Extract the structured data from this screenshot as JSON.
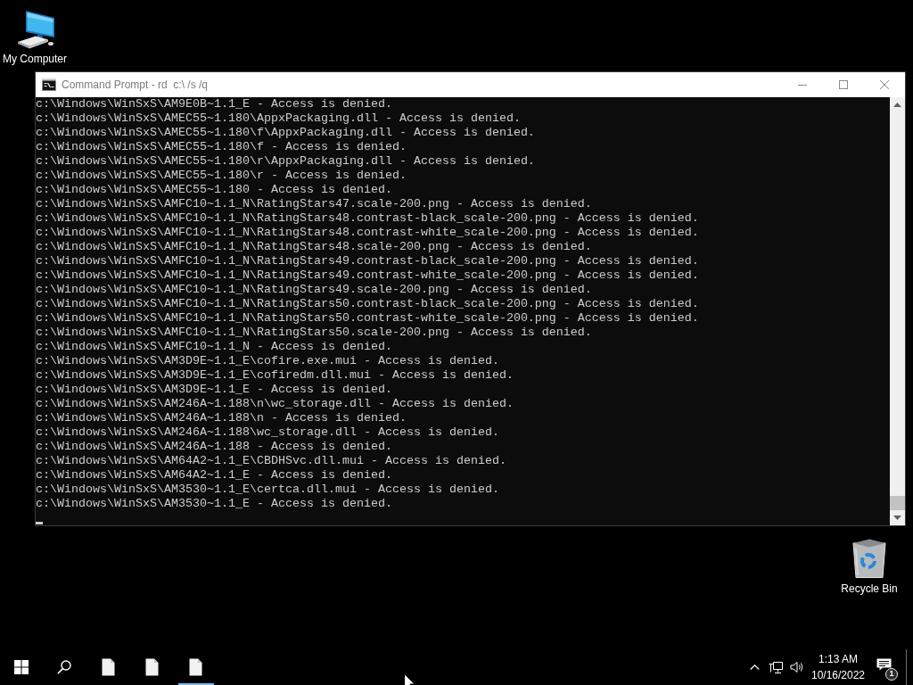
{
  "desktop_icons": [
    {
      "kind": "computer",
      "label": "My Computer"
    },
    {
      "kind": "recycle-bin",
      "label": "Recycle Bin"
    }
  ],
  "window": {
    "title": "Command Prompt - rd  c:\\ /s /q",
    "lines": [
      "c:\\Windows\\WinSxS\\AM9E0B~1.1_E - Access is denied.",
      "c:\\Windows\\WinSxS\\AMEC55~1.180\\AppxPackaging.dll - Access is denied.",
      "c:\\Windows\\WinSxS\\AMEC55~1.180\\f\\AppxPackaging.dll - Access is denied.",
      "c:\\Windows\\WinSxS\\AMEC55~1.180\\f - Access is denied.",
      "c:\\Windows\\WinSxS\\AMEC55~1.180\\r\\AppxPackaging.dll - Access is denied.",
      "c:\\Windows\\WinSxS\\AMEC55~1.180\\r - Access is denied.",
      "c:\\Windows\\WinSxS\\AMEC55~1.180 - Access is denied.",
      "c:\\Windows\\WinSxS\\AMFC10~1.1_N\\RatingStars47.scale-200.png - Access is denied.",
      "c:\\Windows\\WinSxS\\AMFC10~1.1_N\\RatingStars48.contrast-black_scale-200.png - Access is denied.",
      "c:\\Windows\\WinSxS\\AMFC10~1.1_N\\RatingStars48.contrast-white_scale-200.png - Access is denied.",
      "c:\\Windows\\WinSxS\\AMFC10~1.1_N\\RatingStars48.scale-200.png - Access is denied.",
      "c:\\Windows\\WinSxS\\AMFC10~1.1_N\\RatingStars49.contrast-black_scale-200.png - Access is denied.",
      "c:\\Windows\\WinSxS\\AMFC10~1.1_N\\RatingStars49.contrast-white_scale-200.png - Access is denied.",
      "c:\\Windows\\WinSxS\\AMFC10~1.1_N\\RatingStars49.scale-200.png - Access is denied.",
      "c:\\Windows\\WinSxS\\AMFC10~1.1_N\\RatingStars50.contrast-black_scale-200.png - Access is denied.",
      "c:\\Windows\\WinSxS\\AMFC10~1.1_N\\RatingStars50.contrast-white_scale-200.png - Access is denied.",
      "c:\\Windows\\WinSxS\\AMFC10~1.1_N\\RatingStars50.scale-200.png - Access is denied.",
      "c:\\Windows\\WinSxS\\AMFC10~1.1_N - Access is denied.",
      "c:\\Windows\\WinSxS\\AM3D9E~1.1_E\\cofire.exe.mui - Access is denied.",
      "c:\\Windows\\WinSxS\\AM3D9E~1.1_E\\cofiredm.dll.mui - Access is denied.",
      "c:\\Windows\\WinSxS\\AM3D9E~1.1_E - Access is denied.",
      "c:\\Windows\\WinSxS\\AM246A~1.188\\n\\wc_storage.dll - Access is denied.",
      "c:\\Windows\\WinSxS\\AM246A~1.188\\n - Access is denied.",
      "c:\\Windows\\WinSxS\\AM246A~1.188\\wc_storage.dll - Access is denied.",
      "c:\\Windows\\WinSxS\\AM246A~1.188 - Access is denied.",
      "c:\\Windows\\WinSxS\\AM64A2~1.1_E\\CBDHSvc.dll.mui - Access is denied.",
      "c:\\Windows\\WinSxS\\AM64A2~1.1_E - Access is denied.",
      "c:\\Windows\\WinSxS\\AM3530~1.1_E\\certca.dll.mui - Access is denied.",
      "c:\\Windows\\WinSxS\\AM3530~1.1_E - Access is denied."
    ]
  },
  "taskbar": {
    "apps": [
      {
        "selected": false
      },
      {
        "selected": false
      },
      {
        "selected": true
      }
    ],
    "time": "1:13 AM",
    "date": "10/16/2022",
    "notification_count": "1"
  }
}
